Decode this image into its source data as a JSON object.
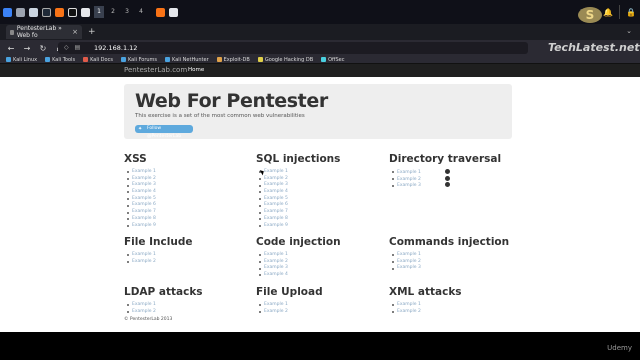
{
  "os": {
    "workspaces": [
      "1",
      "2",
      "3",
      "4"
    ],
    "tray_glyphs": [
      "♪",
      "▣",
      "🔔",
      "🔒"
    ]
  },
  "browser": {
    "tab_title": "PentesterLab » Web fo",
    "url": "192.168.1.12",
    "watermark": "TechLatest.net",
    "bookmarks": [
      "Kali Linux",
      "Kali Tools",
      "Kali Docs",
      "Kali Forums",
      "Kali NetHunter",
      "Exploit-DB",
      "Google Hacking DB",
      "OffSec"
    ],
    "bookmark_colors": [
      "#4aa3e0",
      "#4aa3e0",
      "#e05b4a",
      "#4aa3e0",
      "#4aa3e0",
      "#e0a24a",
      "#e0d04a",
      "#4ad0e0"
    ]
  },
  "site": {
    "brand": "PentesterLab.com",
    "nav_home": "Home",
    "hero_title": "Web For Pentester",
    "hero_subtitle": "This exercise is a set of the most common web vulnerabilities",
    "follow_label": "Follow @PentesterLab",
    "footer": "© PentesterLab 2013"
  },
  "sections": [
    {
      "title": "XSS",
      "items": [
        "Example 1",
        "Example 2",
        "Example 3",
        "Example 4",
        "Example 5",
        "Example 6",
        "Example 7",
        "Example 8",
        "Example 9"
      ]
    },
    {
      "title": "SQL injections",
      "items": [
        "Example 1",
        "Example 2",
        "Example 3",
        "Example 4",
        "Example 5",
        "Example 6",
        "Example 7",
        "Example 8",
        "Example 9"
      ]
    },
    {
      "title": "Directory traversal",
      "items": [
        "Example 1",
        "Example 2",
        "Example 3"
      ]
    },
    {
      "title": "File Include",
      "items": [
        "Example 1",
        "Example 2"
      ]
    },
    {
      "title": "Code injection",
      "items": [
        "Example 1",
        "Example 2",
        "Example 3",
        "Example 4"
      ]
    },
    {
      "title": "Commands injection",
      "items": [
        "Example 1",
        "Example 2",
        "Example 3"
      ]
    },
    {
      "title": "LDAP attacks",
      "items": [
        "Example 1",
        "Example 2"
      ]
    },
    {
      "title": "File Upload",
      "items": [
        "Example 1",
        "Example 2"
      ]
    },
    {
      "title": "XML attacks",
      "items": [
        "Example 1",
        "Example 2"
      ]
    }
  ],
  "overlay": {
    "udemy": "Udemy"
  }
}
